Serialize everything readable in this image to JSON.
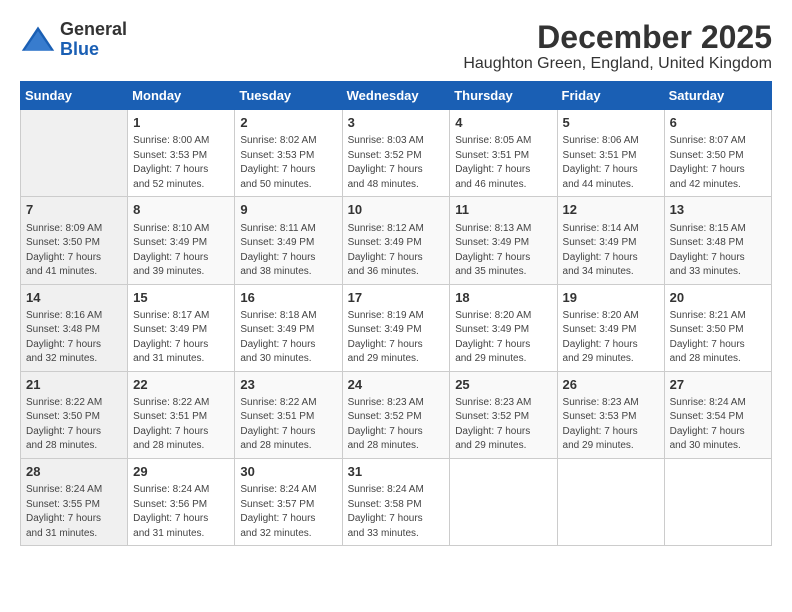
{
  "logo": {
    "line1": "General",
    "line2": "Blue"
  },
  "title": "December 2025",
  "location": "Haughton Green, England, United Kingdom",
  "days_header": [
    "Sunday",
    "Monday",
    "Tuesday",
    "Wednesday",
    "Thursday",
    "Friday",
    "Saturday"
  ],
  "weeks": [
    [
      {
        "day": "",
        "info": ""
      },
      {
        "day": "1",
        "info": "Sunrise: 8:00 AM\nSunset: 3:53 PM\nDaylight: 7 hours\nand 52 minutes."
      },
      {
        "day": "2",
        "info": "Sunrise: 8:02 AM\nSunset: 3:53 PM\nDaylight: 7 hours\nand 50 minutes."
      },
      {
        "day": "3",
        "info": "Sunrise: 8:03 AM\nSunset: 3:52 PM\nDaylight: 7 hours\nand 48 minutes."
      },
      {
        "day": "4",
        "info": "Sunrise: 8:05 AM\nSunset: 3:51 PM\nDaylight: 7 hours\nand 46 minutes."
      },
      {
        "day": "5",
        "info": "Sunrise: 8:06 AM\nSunset: 3:51 PM\nDaylight: 7 hours\nand 44 minutes."
      },
      {
        "day": "6",
        "info": "Sunrise: 8:07 AM\nSunset: 3:50 PM\nDaylight: 7 hours\nand 42 minutes."
      }
    ],
    [
      {
        "day": "7",
        "info": "Sunrise: 8:09 AM\nSunset: 3:50 PM\nDaylight: 7 hours\nand 41 minutes."
      },
      {
        "day": "8",
        "info": "Sunrise: 8:10 AM\nSunset: 3:49 PM\nDaylight: 7 hours\nand 39 minutes."
      },
      {
        "day": "9",
        "info": "Sunrise: 8:11 AM\nSunset: 3:49 PM\nDaylight: 7 hours\nand 38 minutes."
      },
      {
        "day": "10",
        "info": "Sunrise: 8:12 AM\nSunset: 3:49 PM\nDaylight: 7 hours\nand 36 minutes."
      },
      {
        "day": "11",
        "info": "Sunrise: 8:13 AM\nSunset: 3:49 PM\nDaylight: 7 hours\nand 35 minutes."
      },
      {
        "day": "12",
        "info": "Sunrise: 8:14 AM\nSunset: 3:49 PM\nDaylight: 7 hours\nand 34 minutes."
      },
      {
        "day": "13",
        "info": "Sunrise: 8:15 AM\nSunset: 3:48 PM\nDaylight: 7 hours\nand 33 minutes."
      }
    ],
    [
      {
        "day": "14",
        "info": "Sunrise: 8:16 AM\nSunset: 3:48 PM\nDaylight: 7 hours\nand 32 minutes."
      },
      {
        "day": "15",
        "info": "Sunrise: 8:17 AM\nSunset: 3:49 PM\nDaylight: 7 hours\nand 31 minutes."
      },
      {
        "day": "16",
        "info": "Sunrise: 8:18 AM\nSunset: 3:49 PM\nDaylight: 7 hours\nand 30 minutes."
      },
      {
        "day": "17",
        "info": "Sunrise: 8:19 AM\nSunset: 3:49 PM\nDaylight: 7 hours\nand 29 minutes."
      },
      {
        "day": "18",
        "info": "Sunrise: 8:20 AM\nSunset: 3:49 PM\nDaylight: 7 hours\nand 29 minutes."
      },
      {
        "day": "19",
        "info": "Sunrise: 8:20 AM\nSunset: 3:49 PM\nDaylight: 7 hours\nand 29 minutes."
      },
      {
        "day": "20",
        "info": "Sunrise: 8:21 AM\nSunset: 3:50 PM\nDaylight: 7 hours\nand 28 minutes."
      }
    ],
    [
      {
        "day": "21",
        "info": "Sunrise: 8:22 AM\nSunset: 3:50 PM\nDaylight: 7 hours\nand 28 minutes."
      },
      {
        "day": "22",
        "info": "Sunrise: 8:22 AM\nSunset: 3:51 PM\nDaylight: 7 hours\nand 28 minutes."
      },
      {
        "day": "23",
        "info": "Sunrise: 8:22 AM\nSunset: 3:51 PM\nDaylight: 7 hours\nand 28 minutes."
      },
      {
        "day": "24",
        "info": "Sunrise: 8:23 AM\nSunset: 3:52 PM\nDaylight: 7 hours\nand 28 minutes."
      },
      {
        "day": "25",
        "info": "Sunrise: 8:23 AM\nSunset: 3:52 PM\nDaylight: 7 hours\nand 29 minutes."
      },
      {
        "day": "26",
        "info": "Sunrise: 8:23 AM\nSunset: 3:53 PM\nDaylight: 7 hours\nand 29 minutes."
      },
      {
        "day": "27",
        "info": "Sunrise: 8:24 AM\nSunset: 3:54 PM\nDaylight: 7 hours\nand 30 minutes."
      }
    ],
    [
      {
        "day": "28",
        "info": "Sunrise: 8:24 AM\nSunset: 3:55 PM\nDaylight: 7 hours\nand 31 minutes."
      },
      {
        "day": "29",
        "info": "Sunrise: 8:24 AM\nSunset: 3:56 PM\nDaylight: 7 hours\nand 31 minutes."
      },
      {
        "day": "30",
        "info": "Sunrise: 8:24 AM\nSunset: 3:57 PM\nDaylight: 7 hours\nand 32 minutes."
      },
      {
        "day": "31",
        "info": "Sunrise: 8:24 AM\nSunset: 3:58 PM\nDaylight: 7 hours\nand 33 minutes."
      },
      {
        "day": "",
        "info": ""
      },
      {
        "day": "",
        "info": ""
      },
      {
        "day": "",
        "info": ""
      }
    ]
  ]
}
